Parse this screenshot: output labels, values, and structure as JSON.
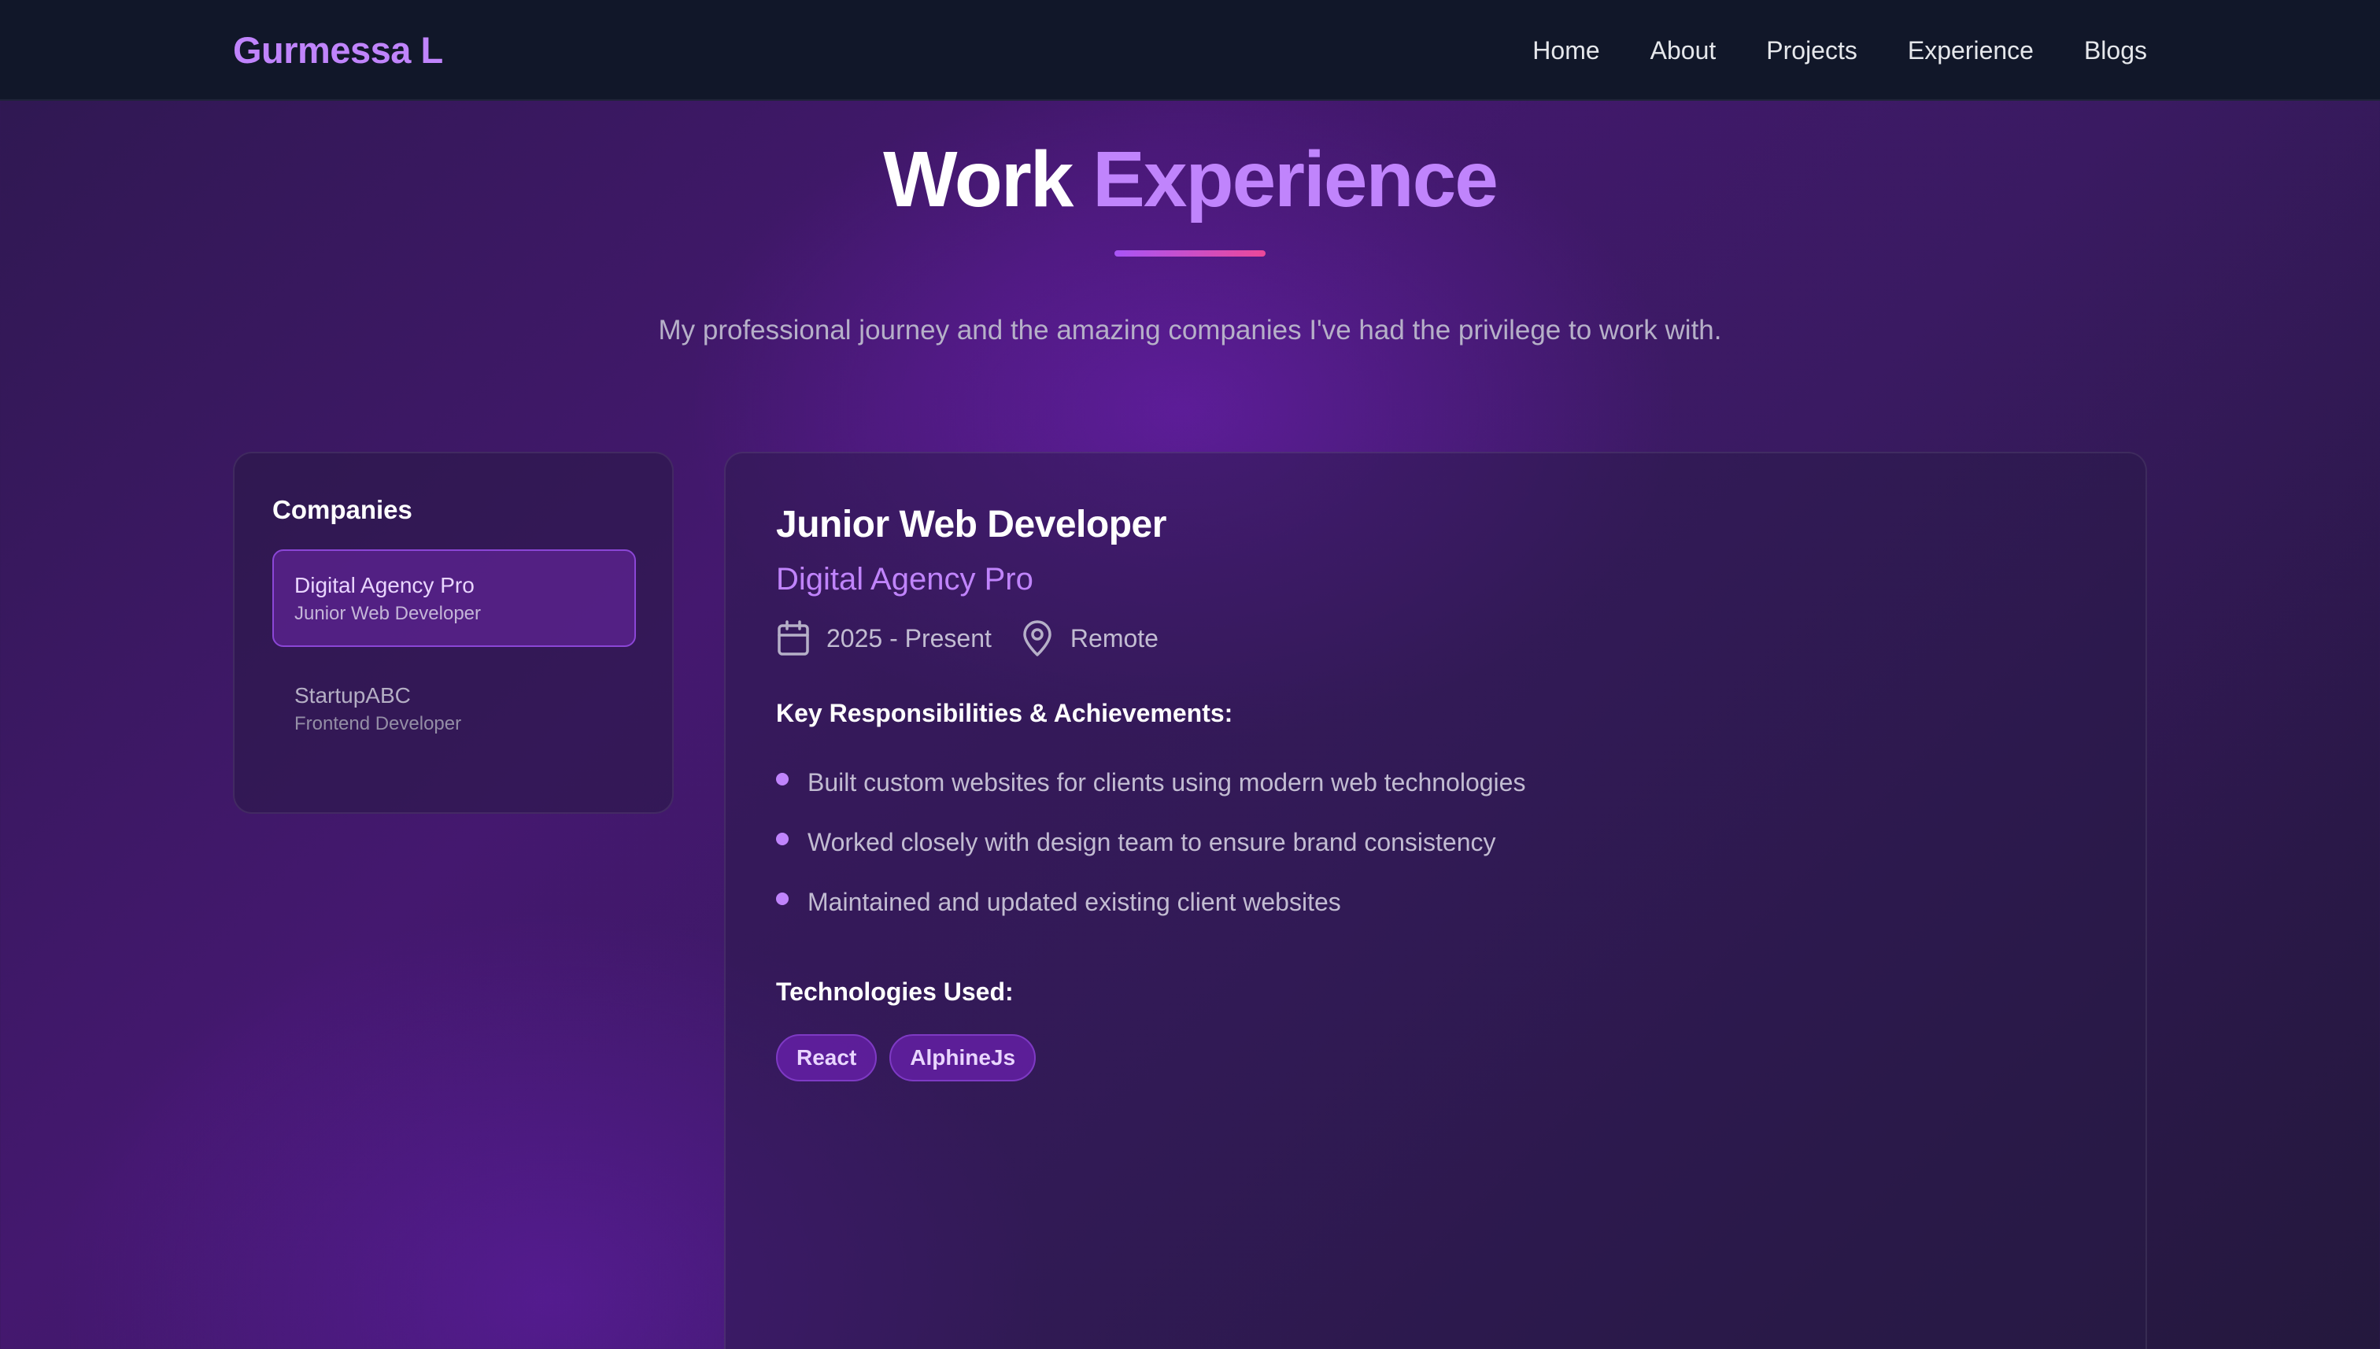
{
  "nav": {
    "brand": "Gurmessa L",
    "links": [
      "Home",
      "About",
      "Projects",
      "Experience",
      "Blogs"
    ]
  },
  "header": {
    "title_part1": "Work",
    "title_part2": "Experience",
    "subtitle": "My professional journey and the amazing companies I've had the privilege to work with."
  },
  "sidebar": {
    "title": "Companies",
    "companies": [
      {
        "name": "Digital Agency Pro",
        "role": "Junior Web Developer",
        "active": true
      },
      {
        "name": "StartupABC",
        "role": "Frontend Developer",
        "active": false
      }
    ]
  },
  "detail": {
    "job_title": "Junior Web Developer",
    "company": "Digital Agency Pro",
    "period": "2025 - Present",
    "location": "Remote",
    "period_icon": "calendar-icon",
    "location_icon": "map-pin-icon",
    "responsibilities_label": "Key Responsibilities & Achievements:",
    "responsibilities": [
      "Built custom websites for clients using modern web technologies",
      "Worked closely with design team to ensure brand consistency",
      "Maintained and updated existing client websites"
    ],
    "technologies_label": "Technologies Used:",
    "technologies": [
      "React",
      "AlphineJs"
    ]
  },
  "colors": {
    "accent": "#c084fc",
    "nav_bg": "#111729",
    "underline_start": "#a855f7",
    "underline_end": "#ec4899"
  }
}
